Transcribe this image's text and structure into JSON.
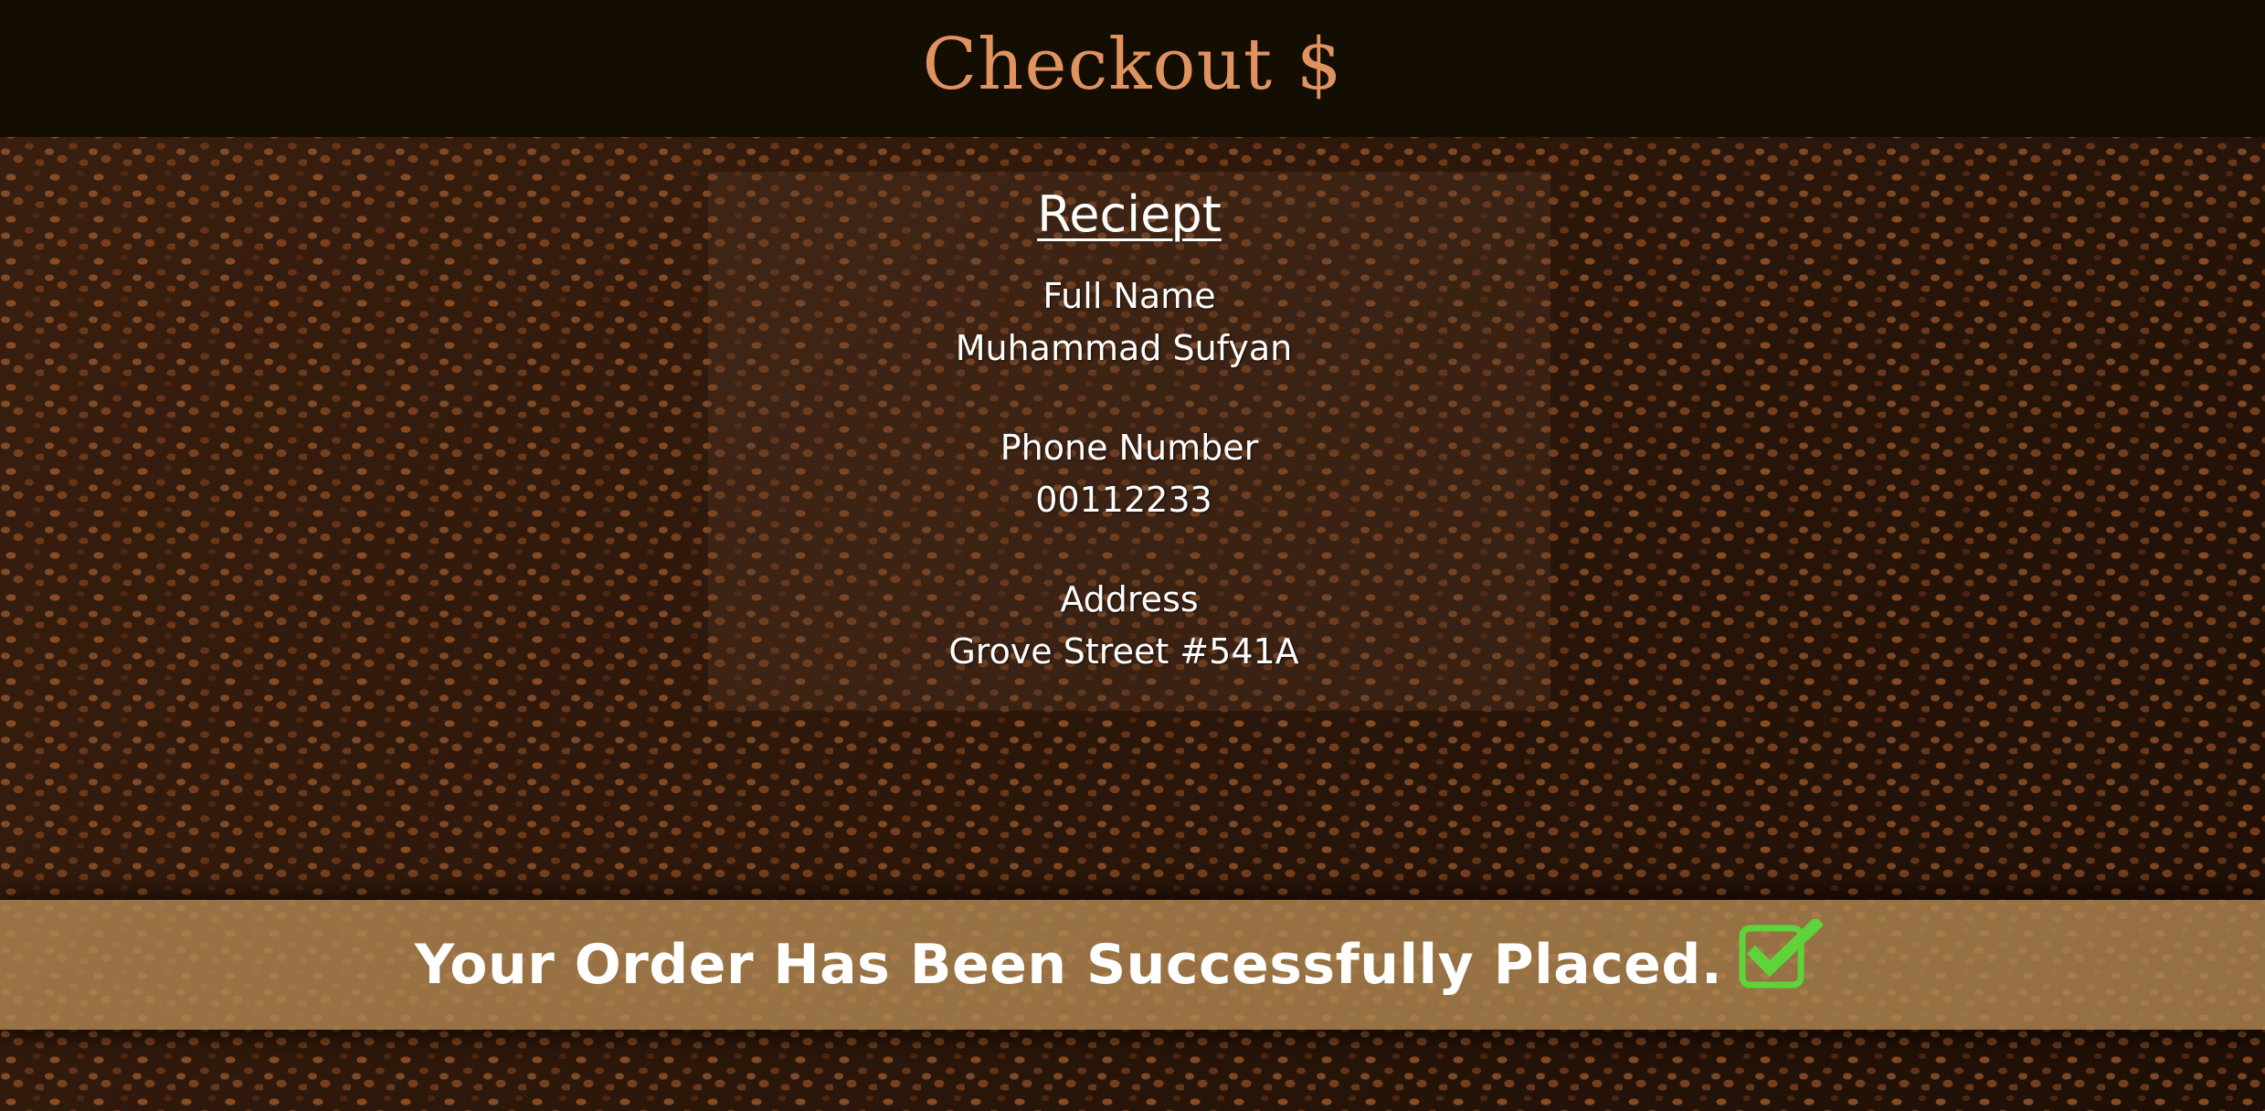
{
  "header": {
    "title": "Checkout $"
  },
  "receipt": {
    "title": "Reciept",
    "fields": [
      {
        "label": "Full Name",
        "value": "Muhammad Sufyan"
      },
      {
        "label": "Phone Number",
        "value": "00112233"
      },
      {
        "label": "Address",
        "value": "Grove Street #541A"
      }
    ]
  },
  "banner": {
    "message": "Your Order Has Been Successfully Placed.",
    "icon": "check-box-icon",
    "icon_color": "#5fd33a"
  },
  "colors": {
    "header_bg": "#140d02",
    "header_text": "#e0925f",
    "banner_bg": "#b08652"
  }
}
